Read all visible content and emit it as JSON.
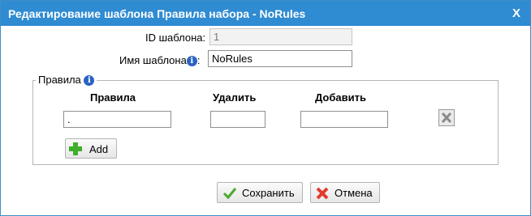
{
  "dialog": {
    "title": "Редактирование шаблона Правила набора - NoRules",
    "close_label": "X"
  },
  "form": {
    "id_label": "ID шаблона:",
    "id_value": "1",
    "name_label": "Имя шаблона",
    "name_colon": ":",
    "name_value": "NoRules"
  },
  "rules": {
    "legend": "Правила",
    "columns": [
      "Правила",
      "Удалить",
      "Добавить"
    ],
    "row": {
      "rule": ".",
      "delete": "",
      "add": ""
    },
    "add_button_label": "Add"
  },
  "footer": {
    "save_label": "Сохранить",
    "cancel_label": "Отмена"
  },
  "colors": {
    "titlebar": "#2f8bd2",
    "info_icon": "#2a63c4",
    "add_icon": "#3fae2a",
    "cancel_icon": "#e23b2e"
  }
}
